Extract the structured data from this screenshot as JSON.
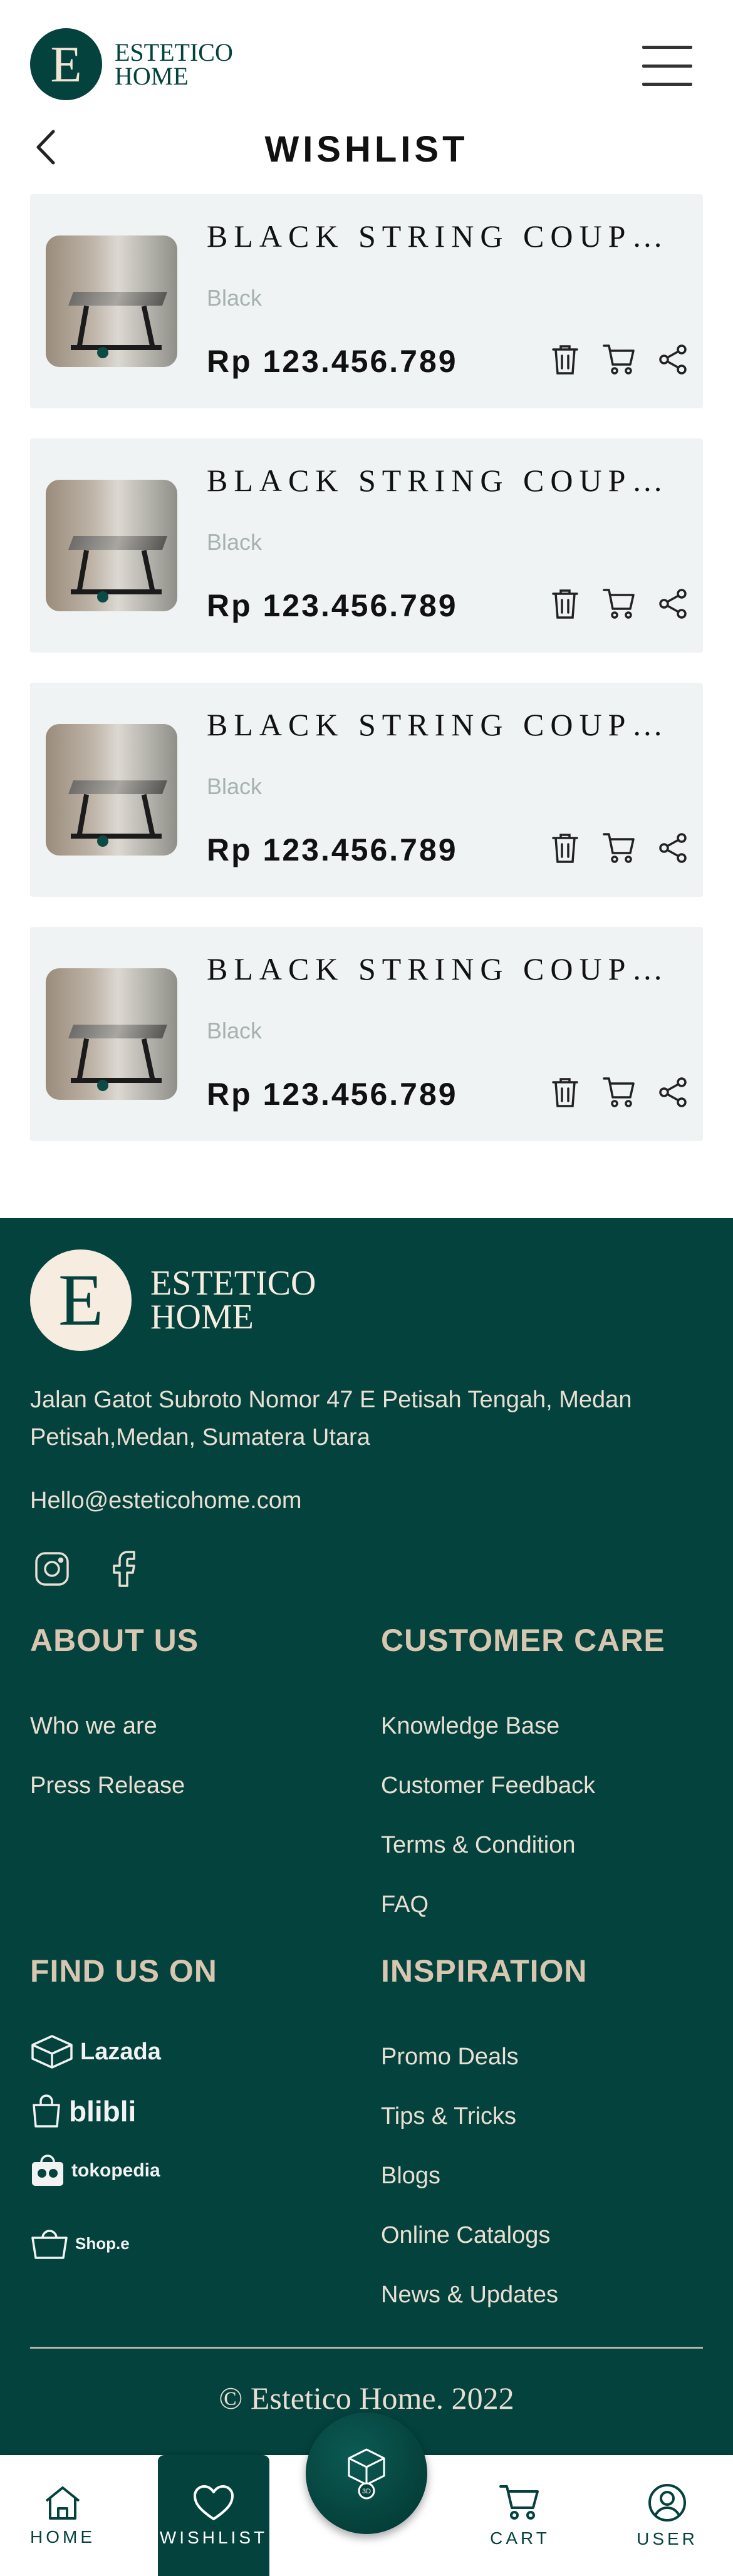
{
  "header": {
    "logo_letter": "E",
    "logo_line1": "ESTETICO",
    "logo_line2": "HOME",
    "page_title": "WISHLIST"
  },
  "wishlist": {
    "items": [
      {
        "title": "BLACK STRING COUPLE COFFEE TABLE",
        "variant": "Black",
        "price": "Rp 123.456.789"
      },
      {
        "title": "BLACK STRING COUPLE COFFEE TABLE",
        "variant": "Black",
        "price": "Rp 123.456.789"
      },
      {
        "title": "BLACK STRING COUPLE COFFEE TABLE",
        "variant": "Black",
        "price": "Rp 123.456.789"
      },
      {
        "title": "BLACK STRING COUPLE COFFEE TABLE",
        "variant": "Black",
        "price": "Rp 123.456.789"
      }
    ]
  },
  "footer": {
    "logo_letter": "E",
    "logo_line1": "ESTETICO",
    "logo_line2": "HOME",
    "address": "Jalan Gatot Subroto Nomor 47 E Petisah Tengah, Medan Petisah,Medan, Sumatera Utara",
    "email": "Hello@esteticohome.com",
    "about_heading": "ABOUT US",
    "about_links": [
      "Who we are",
      "Press Release"
    ],
    "care_heading": "CUSTOMER CARE",
    "care_links": [
      "Knowledge Base",
      "Customer Feedback",
      "Terms & Condition",
      "FAQ"
    ],
    "find_heading": "FIND US ON",
    "shops": [
      "Lazada",
      "blibli",
      "tokopedia",
      "Shop.e"
    ],
    "inspiration_heading": "INSPIRATION",
    "inspiration_links": [
      "Promo Deals",
      "Tips & Tricks",
      "Blogs",
      "Online Catalogs",
      "News & Updates"
    ],
    "copyright": "© Estetico Home. 2022"
  },
  "bottom_nav": {
    "home": "HOME",
    "wishlist": "WISHLIST",
    "center_badge": "3D",
    "cart": "CART",
    "user": "USER"
  },
  "colors": {
    "brand_dark_green": "#03423d",
    "card_background": "#f0f3f3",
    "footer_heading": "#d9c6b0"
  }
}
